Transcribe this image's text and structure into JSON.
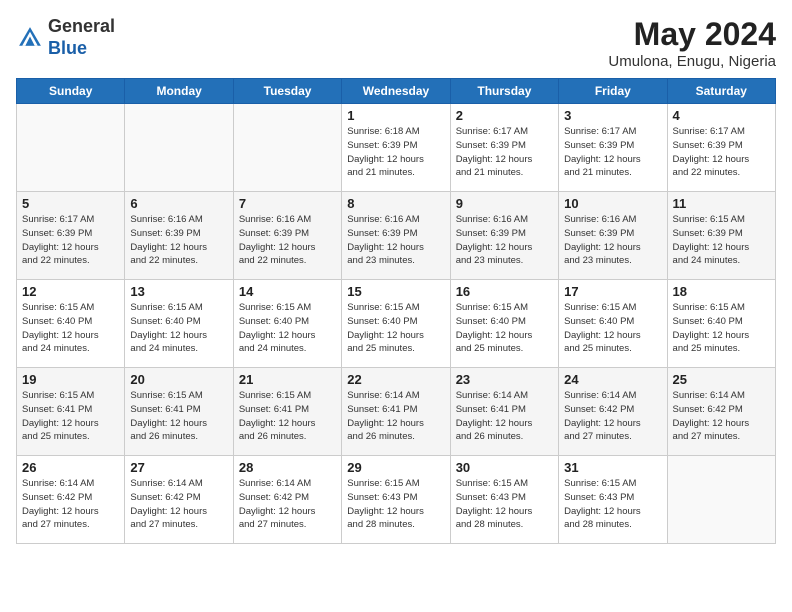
{
  "header": {
    "logo_general": "General",
    "logo_blue": "Blue",
    "month_year": "May 2024",
    "location": "Umulona, Enugu, Nigeria"
  },
  "days_of_week": [
    "Sunday",
    "Monday",
    "Tuesday",
    "Wednesday",
    "Thursday",
    "Friday",
    "Saturday"
  ],
  "weeks": [
    [
      {
        "day": "",
        "info": ""
      },
      {
        "day": "",
        "info": ""
      },
      {
        "day": "",
        "info": ""
      },
      {
        "day": "1",
        "info": "Sunrise: 6:18 AM\nSunset: 6:39 PM\nDaylight: 12 hours\nand 21 minutes."
      },
      {
        "day": "2",
        "info": "Sunrise: 6:17 AM\nSunset: 6:39 PM\nDaylight: 12 hours\nand 21 minutes."
      },
      {
        "day": "3",
        "info": "Sunrise: 6:17 AM\nSunset: 6:39 PM\nDaylight: 12 hours\nand 21 minutes."
      },
      {
        "day": "4",
        "info": "Sunrise: 6:17 AM\nSunset: 6:39 PM\nDaylight: 12 hours\nand 22 minutes."
      }
    ],
    [
      {
        "day": "5",
        "info": "Sunrise: 6:17 AM\nSunset: 6:39 PM\nDaylight: 12 hours\nand 22 minutes."
      },
      {
        "day": "6",
        "info": "Sunrise: 6:16 AM\nSunset: 6:39 PM\nDaylight: 12 hours\nand 22 minutes."
      },
      {
        "day": "7",
        "info": "Sunrise: 6:16 AM\nSunset: 6:39 PM\nDaylight: 12 hours\nand 22 minutes."
      },
      {
        "day": "8",
        "info": "Sunrise: 6:16 AM\nSunset: 6:39 PM\nDaylight: 12 hours\nand 23 minutes."
      },
      {
        "day": "9",
        "info": "Sunrise: 6:16 AM\nSunset: 6:39 PM\nDaylight: 12 hours\nand 23 minutes."
      },
      {
        "day": "10",
        "info": "Sunrise: 6:16 AM\nSunset: 6:39 PM\nDaylight: 12 hours\nand 23 minutes."
      },
      {
        "day": "11",
        "info": "Sunrise: 6:15 AM\nSunset: 6:39 PM\nDaylight: 12 hours\nand 24 minutes."
      }
    ],
    [
      {
        "day": "12",
        "info": "Sunrise: 6:15 AM\nSunset: 6:40 PM\nDaylight: 12 hours\nand 24 minutes."
      },
      {
        "day": "13",
        "info": "Sunrise: 6:15 AM\nSunset: 6:40 PM\nDaylight: 12 hours\nand 24 minutes."
      },
      {
        "day": "14",
        "info": "Sunrise: 6:15 AM\nSunset: 6:40 PM\nDaylight: 12 hours\nand 24 minutes."
      },
      {
        "day": "15",
        "info": "Sunrise: 6:15 AM\nSunset: 6:40 PM\nDaylight: 12 hours\nand 25 minutes."
      },
      {
        "day": "16",
        "info": "Sunrise: 6:15 AM\nSunset: 6:40 PM\nDaylight: 12 hours\nand 25 minutes."
      },
      {
        "day": "17",
        "info": "Sunrise: 6:15 AM\nSunset: 6:40 PM\nDaylight: 12 hours\nand 25 minutes."
      },
      {
        "day": "18",
        "info": "Sunrise: 6:15 AM\nSunset: 6:40 PM\nDaylight: 12 hours\nand 25 minutes."
      }
    ],
    [
      {
        "day": "19",
        "info": "Sunrise: 6:15 AM\nSunset: 6:41 PM\nDaylight: 12 hours\nand 25 minutes."
      },
      {
        "day": "20",
        "info": "Sunrise: 6:15 AM\nSunset: 6:41 PM\nDaylight: 12 hours\nand 26 minutes."
      },
      {
        "day": "21",
        "info": "Sunrise: 6:15 AM\nSunset: 6:41 PM\nDaylight: 12 hours\nand 26 minutes."
      },
      {
        "day": "22",
        "info": "Sunrise: 6:14 AM\nSunset: 6:41 PM\nDaylight: 12 hours\nand 26 minutes."
      },
      {
        "day": "23",
        "info": "Sunrise: 6:14 AM\nSunset: 6:41 PM\nDaylight: 12 hours\nand 26 minutes."
      },
      {
        "day": "24",
        "info": "Sunrise: 6:14 AM\nSunset: 6:42 PM\nDaylight: 12 hours\nand 27 minutes."
      },
      {
        "day": "25",
        "info": "Sunrise: 6:14 AM\nSunset: 6:42 PM\nDaylight: 12 hours\nand 27 minutes."
      }
    ],
    [
      {
        "day": "26",
        "info": "Sunrise: 6:14 AM\nSunset: 6:42 PM\nDaylight: 12 hours\nand 27 minutes."
      },
      {
        "day": "27",
        "info": "Sunrise: 6:14 AM\nSunset: 6:42 PM\nDaylight: 12 hours\nand 27 minutes."
      },
      {
        "day": "28",
        "info": "Sunrise: 6:14 AM\nSunset: 6:42 PM\nDaylight: 12 hours\nand 27 minutes."
      },
      {
        "day": "29",
        "info": "Sunrise: 6:15 AM\nSunset: 6:43 PM\nDaylight: 12 hours\nand 28 minutes."
      },
      {
        "day": "30",
        "info": "Sunrise: 6:15 AM\nSunset: 6:43 PM\nDaylight: 12 hours\nand 28 minutes."
      },
      {
        "day": "31",
        "info": "Sunrise: 6:15 AM\nSunset: 6:43 PM\nDaylight: 12 hours\nand 28 minutes."
      },
      {
        "day": "",
        "info": ""
      }
    ]
  ]
}
